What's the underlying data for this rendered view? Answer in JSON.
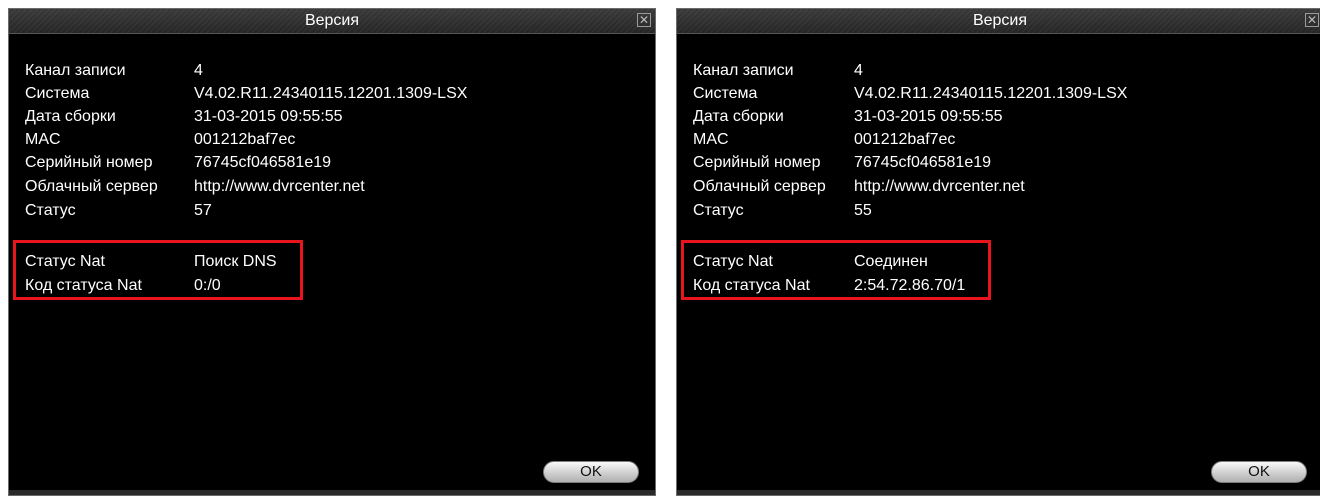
{
  "dialogs": [
    {
      "title": "Версия",
      "close_icon": "close-icon",
      "rows": [
        {
          "label": "Канал записи",
          "value": "4"
        },
        {
          "label": "Система",
          "value": "V4.02.R11.24340115.12201.1309-LSX"
        },
        {
          "label": "Дата сборки",
          "value": "31-03-2015 09:55:55"
        },
        {
          "label": "MAC",
          "value": "001212baf7ec"
        },
        {
          "label": "Серийный номер",
          "value": "76745cf046581e19"
        },
        {
          "label": "Облачный сервер",
          "value": "http://www.dvrcenter.net"
        },
        {
          "label": "Статус",
          "value": "57"
        }
      ],
      "nat_rows": [
        {
          "label": "Статус Nat",
          "value": "Поиск DNS"
        },
        {
          "label": "Код статуса Nat",
          "value": "0:/0"
        }
      ],
      "ok_label": "OK"
    },
    {
      "title": "Версия",
      "close_icon": "close-icon",
      "rows": [
        {
          "label": "Канал записи",
          "value": "4"
        },
        {
          "label": "Система",
          "value": "V4.02.R11.24340115.12201.1309-LSX"
        },
        {
          "label": "Дата сборки",
          "value": "31-03-2015 09:55:55"
        },
        {
          "label": "MAC",
          "value": "001212baf7ec"
        },
        {
          "label": "Серийный номер",
          "value": "76745cf046581e19"
        },
        {
          "label": "Облачный сервер",
          "value": "http://www.dvrcenter.net"
        },
        {
          "label": "Статус",
          "value": "55"
        }
      ],
      "nat_rows": [
        {
          "label": "Статус Nat",
          "value": "Соединен"
        },
        {
          "label": "Код статуса Nat",
          "value": "2:54.72.86.70/1"
        }
      ],
      "ok_label": "OK"
    }
  ],
  "colors": {
    "background": "#000000",
    "text": "#ffffff",
    "highlight": "#e8141e"
  }
}
